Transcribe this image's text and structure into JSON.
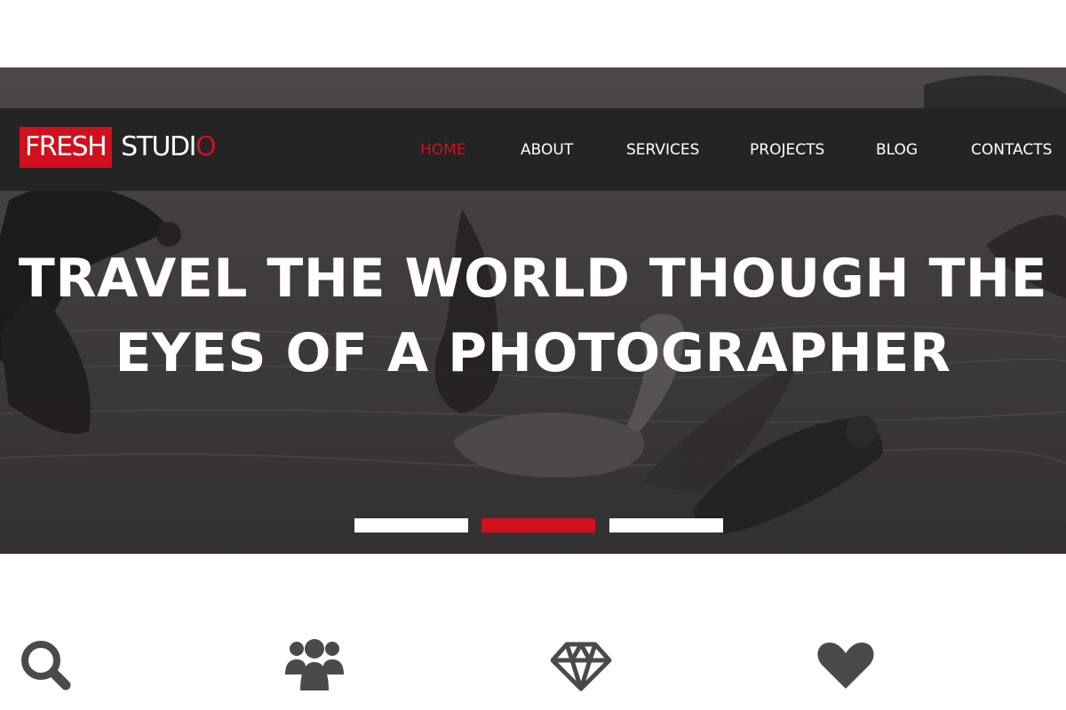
{
  "brand": {
    "box_text": "FRESH",
    "word_text": "STUDI",
    "word_accent": "O"
  },
  "nav": {
    "items": [
      {
        "label": "HOME",
        "active": true
      },
      {
        "label": "ABOUT",
        "active": false
      },
      {
        "label": "SERVICES",
        "active": false
      },
      {
        "label": "PROJECTS",
        "active": false
      },
      {
        "label": "BLOG",
        "active": false
      },
      {
        "label": "CONTACTS",
        "active": false
      }
    ]
  },
  "hero": {
    "headline_line1": "TRAVEL THE WORLD THOUGH THE",
    "headline_line2": "EYES OF A PHOTOGRAPHER",
    "slides_total": 3,
    "active_slide": 2
  },
  "features": {
    "icons": [
      "search-icon",
      "users-icon",
      "diamond-icon",
      "heart-icon"
    ]
  },
  "colors": {
    "accent": "#d0101d",
    "navbar_bg": "#242424",
    "icon_gray": "#4a4a4a",
    "text_white": "#ffffff"
  }
}
